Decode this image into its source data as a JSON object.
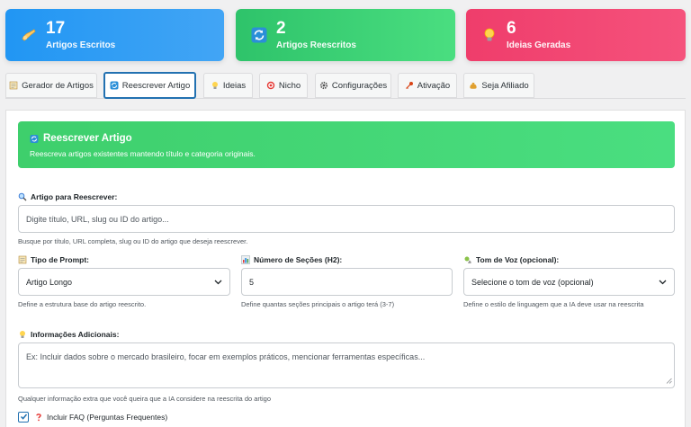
{
  "stats": [
    {
      "value": "17",
      "label": "Artigos Escritos",
      "icon": "writing-hand-icon"
    },
    {
      "value": "2",
      "label": "Artigos Reescritos",
      "icon": "refresh-icon"
    },
    {
      "value": "6",
      "label": "Ideias Geradas",
      "icon": "lightbulb-icon"
    }
  ],
  "tabs": [
    {
      "label": "Gerador de Artigos",
      "icon": "memo-icon"
    },
    {
      "label": "Reescrever Artigo",
      "icon": "refresh-icon",
      "active": true
    },
    {
      "label": "Ideias",
      "icon": "lightbulb-icon"
    },
    {
      "label": "Nicho",
      "icon": "target-icon"
    },
    {
      "label": "Configurações",
      "icon": "gear-icon"
    },
    {
      "label": "Ativação",
      "icon": "key-icon"
    },
    {
      "label": "Seja Afiliado",
      "icon": "money-bag-icon"
    }
  ],
  "hero": {
    "title": "Reescrever Artigo",
    "subtitle": "Reescreva artigos existentes mantendo título e categoria originais."
  },
  "article_field": {
    "label": "Artigo para Reescrever:",
    "placeholder": "Digite título, URL, slug ou ID do artigo...",
    "help": "Busque por título, URL completa, slug ou ID do artigo que deseja reescrever."
  },
  "prompt_type": {
    "label": "Tipo de Prompt:",
    "value": "Artigo Longo",
    "help": "Define a estrutura base do artigo reescrito."
  },
  "sections": {
    "label": "Número de Seções (H2):",
    "value": "5",
    "help": "Define quantas seções principais o artigo terá (3-7)"
  },
  "tone": {
    "label": "Tom de Voz (opcional):",
    "value": "Selecione o tom de voz (opcional)",
    "help": "Define o estilo de linguagem que a IA deve usar na reescrita"
  },
  "additional": {
    "label": "Informações Adicionais:",
    "placeholder": "Ex: Incluir dados sobre o mercado brasileiro, focar em exemplos práticos, mencionar ferramentas específicas...",
    "help": "Qualquer informação extra que você queira que a IA considere na reescrita do artigo"
  },
  "faq": {
    "label": "Incluir FAQ (Perguntas Frequentes)",
    "checked": true
  },
  "colors": {
    "blue": "#2196f3",
    "green": "#3ecf6c",
    "pink": "#ef3d6b",
    "accent": "#2271b1"
  }
}
